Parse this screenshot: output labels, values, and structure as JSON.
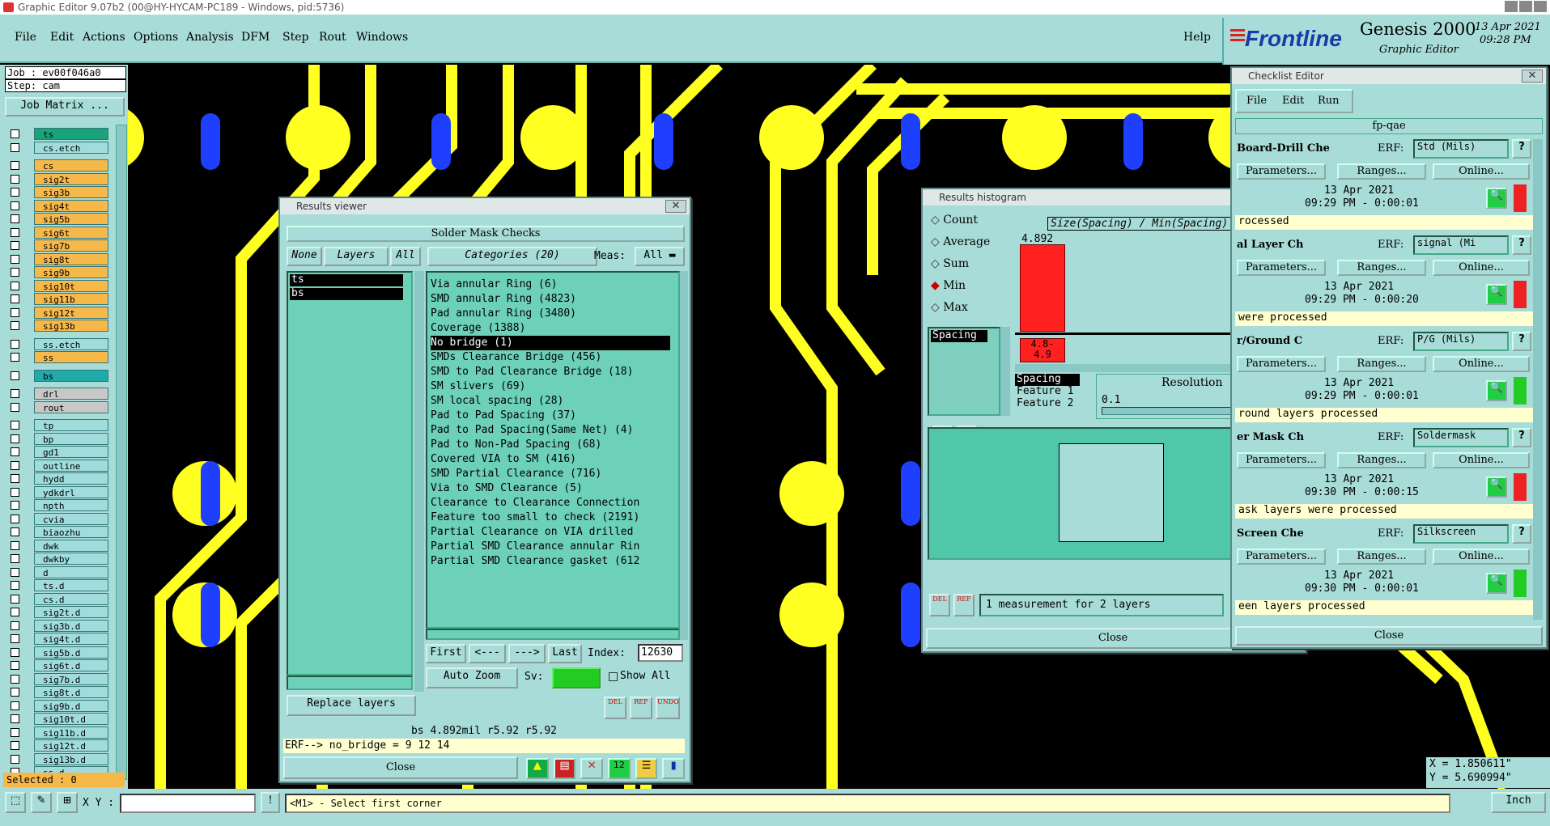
{
  "titlebar": {
    "title": "Graphic Editor 9.07b2 (00@HY-HYCAM-PC189 - Windows, pid:5736)"
  },
  "menu": {
    "items": [
      "File",
      "Edit",
      "Actions",
      "Options",
      "Analysis",
      "DFM",
      "Step",
      "Rout",
      "Windows"
    ],
    "help": "Help"
  },
  "logo": {
    "brand": "Frontline",
    "product": "Genesis 2000",
    "subtitle": "Graphic Editor",
    "date": "13 Apr 2021",
    "time": "09:28 PM"
  },
  "job": {
    "job": "Job : ev00f046a0",
    "step": "Step: cam",
    "matrix_button": "Job Matrix ..."
  },
  "layers": [
    {
      "name": "ts",
      "style": "green"
    },
    {
      "name": "cs.etch",
      "style": "plain"
    },
    {
      "name": "cs",
      "style": "orange"
    },
    {
      "name": "sig2t",
      "style": "orange"
    },
    {
      "name": "sig3b",
      "style": "orange"
    },
    {
      "name": "sig4t",
      "style": "orange"
    },
    {
      "name": "sig5b",
      "style": "orange"
    },
    {
      "name": "sig6t",
      "style": "orange"
    },
    {
      "name": "sig7b",
      "style": "orange"
    },
    {
      "name": "sig8t",
      "style": "orange"
    },
    {
      "name": "sig9b",
      "style": "orange"
    },
    {
      "name": "sig10t",
      "style": "orange"
    },
    {
      "name": "sig11b",
      "style": "orange"
    },
    {
      "name": "sig12t",
      "style": "orange"
    },
    {
      "name": "sig13b",
      "style": "orange"
    },
    {
      "name": "ss.etch",
      "style": "plain"
    },
    {
      "name": "ss",
      "style": "orange"
    },
    {
      "name": "bs",
      "style": "teal"
    },
    {
      "name": "drl",
      "style": "grey"
    },
    {
      "name": "rout",
      "style": "grey"
    },
    {
      "name": "tp",
      "style": "plain"
    },
    {
      "name": "bp",
      "style": "plain"
    },
    {
      "name": "gd1",
      "style": "plain"
    },
    {
      "name": "outline",
      "style": "plain"
    },
    {
      "name": "hydd",
      "style": "plain"
    },
    {
      "name": "ydkdrl",
      "style": "plain"
    },
    {
      "name": "npth",
      "style": "plain"
    },
    {
      "name": "cvia",
      "style": "plain"
    },
    {
      "name": "biaozhu",
      "style": "plain"
    },
    {
      "name": "dwk",
      "style": "plain"
    },
    {
      "name": "dwkby",
      "style": "plain"
    },
    {
      "name": "d",
      "style": "plain"
    },
    {
      "name": "ts.d",
      "style": "plain"
    },
    {
      "name": "cs.d",
      "style": "plain"
    },
    {
      "name": "sig2t.d",
      "style": "plain"
    },
    {
      "name": "sig3b.d",
      "style": "plain"
    },
    {
      "name": "sig4t.d",
      "style": "plain"
    },
    {
      "name": "sig5b.d",
      "style": "plain"
    },
    {
      "name": "sig6t.d",
      "style": "plain"
    },
    {
      "name": "sig7b.d",
      "style": "plain"
    },
    {
      "name": "sig8t.d",
      "style": "plain"
    },
    {
      "name": "sig9b.d",
      "style": "plain"
    },
    {
      "name": "sig10t.d",
      "style": "plain"
    },
    {
      "name": "sig11b.d",
      "style": "plain"
    },
    {
      "name": "sig12t.d",
      "style": "plain"
    },
    {
      "name": "sig13b.d",
      "style": "plain"
    },
    {
      "name": "ss.d",
      "style": "plain"
    }
  ],
  "selected": "Selected : 0",
  "results_viewer": {
    "title": "Results viewer",
    "header": "Solder Mask Checks",
    "none_btn": "None",
    "layers_btn": "Layers",
    "all_btn": "All",
    "categories_btn": "Categories (20)",
    "meas_label": "Meas:",
    "meas_value": "All",
    "layer_list": [
      "ts",
      "bs"
    ],
    "categories": [
      "Via annular Ring (6)",
      "SMD annular Ring (4823)",
      "Pad annular Ring (3480)",
      "Coverage (1388)",
      "No bridge (1)",
      "SMDs Clearance Bridge (456)",
      "SMD to Pad Clearance Bridge (18)",
      "SM slivers (69)",
      "SM local spacing (28)",
      "Pad to Pad Spacing (37)",
      "Pad to Pad Spacing(Same Net) (4)",
      "Pad to Non-Pad Spacing (68)",
      "Covered VIA to SM (416)",
      "SMD Partial Clearance (716)",
      "Via to SMD Clearance (5)",
      "Clearance to Clearance Connection",
      "Feature too small to check (2191)",
      "Partial Clearance on VIA drilled",
      "Partial SMD Clearance annular Rin",
      "Partial SMD Clearance gasket (612"
    ],
    "selected_index": 4,
    "first": "First",
    "prev": "<---",
    "next": "--->",
    "last": "Last",
    "index_label": "Index:",
    "index_value": "12630",
    "auto_zoom": "Auto Zoom",
    "sv_label": "Sv:",
    "show_all": "Show All",
    "replace_layers": "Replace layers",
    "del": "DEL",
    "ref": "REF",
    "undo": "UNDO",
    "status": "bs 4.892mil  r5.92  r5.92",
    "erf": "ERF--> no_bridge = 9 12 14",
    "close": "Close"
  },
  "histogram": {
    "title": "Results histogram",
    "options": [
      "Count",
      "Average",
      "Sum",
      "Min",
      "Max"
    ],
    "selected_option": "Min",
    "chart_title": "Size(Spacing) / Min(Spacing)",
    "bar_value": "4.892",
    "bar_label_1": "4.8-",
    "bar_label_2": "4.9",
    "measure_list": [
      "Spacing"
    ],
    "feature_list": [
      "Spacing",
      "Feature 1",
      "Feature 2"
    ],
    "resolution_label": "Resolution",
    "resolution_value": "0.1",
    "status": "1 measurement for 2 layers",
    "close": "Close",
    "bar_color": "#ff2020"
  },
  "checklist": {
    "title": "Checklist Editor",
    "menu": [
      "File",
      "Edit",
      "Run"
    ],
    "name": "fp-qae",
    "rows": [
      {
        "name": "Board-Drill Che",
        "erf": "Std (Mils)",
        "date": "13 Apr 2021",
        "time": "09:29 PM - 0:00:01",
        "msg": "rocessed",
        "status": "red"
      },
      {
        "name": "al Layer Ch",
        "erf": "signal (Mi",
        "date": "13 Apr 2021",
        "time": "09:29 PM - 0:00:20",
        "msg": "were processed",
        "status": "red"
      },
      {
        "name": "r/Ground C",
        "erf": "P/G (Mils)",
        "date": "13 Apr 2021",
        "time": "09:29 PM - 0:00:01",
        "msg": "round layers processed",
        "status": "green"
      },
      {
        "name": "er Mask Ch",
        "erf": "Soldermask",
        "date": "13 Apr 2021",
        "time": "09:30 PM - 0:00:15",
        "msg": "ask layers were processed",
        "status": "red"
      },
      {
        "name": "Screen Che",
        "erf": "Silkscreen",
        "date": "13 Apr 2021",
        "time": "09:30 PM - 0:00:01",
        "msg": "een layers processed",
        "status": "green"
      }
    ],
    "erf_label": "ERF:",
    "params": "Parameters...",
    "ranges": "Ranges...",
    "online": "Online...",
    "close": "Close"
  },
  "coords": {
    "x": "X = 1.850611\"",
    "y": "Y = 5.690994\""
  },
  "bottom": {
    "xy_label": "X Y :",
    "xy_value": "",
    "hint": "<M1> - Select first corner",
    "units": "Inch"
  }
}
